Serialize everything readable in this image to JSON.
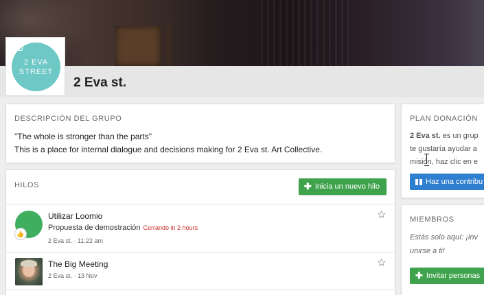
{
  "group": {
    "name": "2 Eva st.",
    "logo_line1": "2 EVA",
    "logo_line2": "STREET"
  },
  "description": {
    "label": "DESCRIPCIÓN DEL GRUPO",
    "line1": "\"The whole is stronger than the parts\"",
    "line2": "This is a place for internal dialogue and decisions making for 2 Eva st. Art Collective."
  },
  "threads": {
    "label": "HILOS",
    "new_button": "Inicia un nuevo hilo",
    "items": [
      {
        "title": "Utilizar Loomio",
        "subtitle": "Propuesta de demostración",
        "closing": "Cerrando in 2 hours",
        "meta": "2 Eva st. · 11:22 am"
      },
      {
        "title": "The Big Meeting",
        "meta": "2 Eva st. · 13 Nov"
      }
    ]
  },
  "plan": {
    "label": "PLAN DONACIÓN",
    "bold": "2 Eva st.",
    "line1_rest": " es un grup",
    "line2": "te gustaría ayudar a",
    "line3": "misión, haz clic en e",
    "button": "Haz una contribu"
  },
  "members": {
    "label": "MIEMBROS",
    "line1": "Estás solo aquí: ¡inv",
    "line2": "unirse a ti!",
    "button": "Invitar personas"
  },
  "icons": {
    "camera": "camera-icon",
    "plus": "plus-icon",
    "star": "star-icon",
    "thumbs_up": "thumbs-up-icon",
    "gift": "gift-icon"
  },
  "colors": {
    "green": "#3fa34d",
    "blue": "#2f7fd0",
    "teal_logo": "#6ec8c6",
    "closing_red": "#cc2a2a"
  }
}
